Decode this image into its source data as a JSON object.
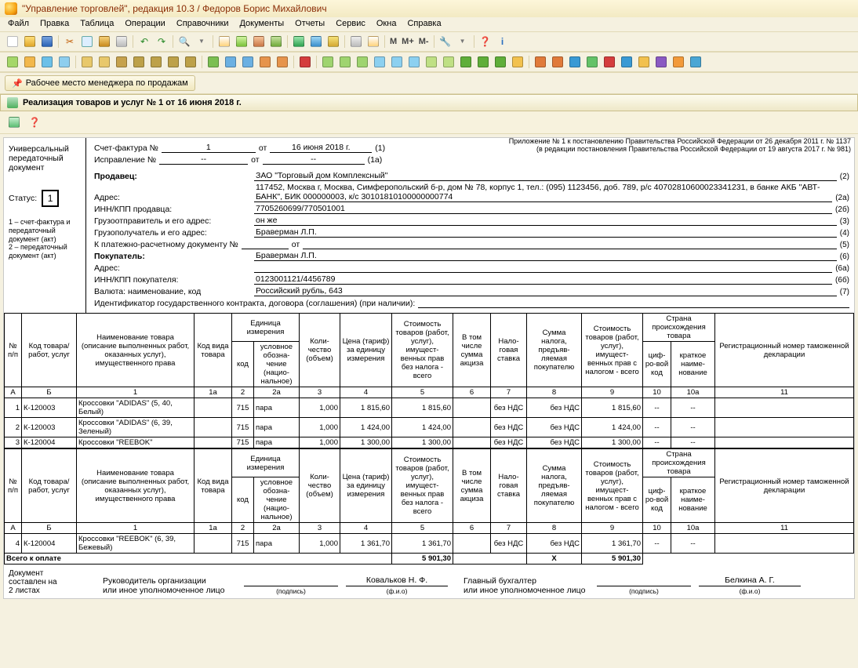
{
  "win": {
    "title": "\"Управление торговлей\", редакция 10.3 / Федоров Борис Михайлович"
  },
  "menu": [
    "Файл",
    "Правка",
    "Таблица",
    "Операции",
    "Справочники",
    "Документы",
    "Отчеты",
    "Сервис",
    "Окна",
    "Справка"
  ],
  "tb_text": {
    "m": "M",
    "mp": "M+",
    "mm": "M-"
  },
  "workspace_tab": "Рабочее место менеджера по продажам",
  "doc_tab": "Реализация товаров и услуг № 1 от 16 июня 2018 г.",
  "left": {
    "upd1": "Универсальный",
    "upd2": "передаточный",
    "upd3": "документ",
    "status_lbl": "Статус:",
    "status_val": "1",
    "note": "1 – счет-фактура и передаточный документ (акт)\n2 – передаточный документ (акт)"
  },
  "hdr_right": {
    "l1": "Приложение № 1 к постановлению Правительства Российской Федерации от 26 декабря 2011 г. № 1137",
    "l2": "(в редакции постановления Правительства Российской Федерации от 19 августа 2017 г. № 981)"
  },
  "hdr": {
    "sf_lbl": "Счет-фактура №",
    "sf_no": "1",
    "sf_ot": "от",
    "sf_date": "16 июня 2018 г.",
    "sf_tail": "(1)",
    "isp_lbl": "Исправление №",
    "isp_no": "--",
    "isp_ot": "от",
    "isp_date": "--",
    "isp_tail": "(1а)",
    "seller_lbl": "Продавец:",
    "seller": "ЗАО \"Торговый дом Комплексный\"",
    "seller_n": "(2)",
    "addr_lbl": "Адрес:",
    "addr": "117452, Москва г, Москва, Симферопольский б-р, дом № 78, корпус 1, тел.: (095) 1123456, доб. 789, р/с 40702810600023341231, в банке АКБ \"АВТ-БАНК\", БИК 000000003, к/с 30101810100000000774",
    "addr_n": "(2а)",
    "inn_s_lbl": "ИНН/КПП продавца:",
    "inn_s": "7705260699/770501001",
    "inn_s_n": "(2б)",
    "go_lbl": "Грузоотправитель и его адрес:",
    "go": "он же",
    "go_n": "(3)",
    "gp_lbl": "Грузополучатель и его адрес:",
    "gp": "Браверман Л.П.",
    "gp_n": "(4)",
    "prd_lbl": "К платежно-расчетному документу №",
    "prd_no": "",
    "prd_ot": "от",
    "prd_date": "",
    "prd_n": "(5)",
    "buyer_lbl": "Покупатель:",
    "buyer": "Браверман Л.П.",
    "buyer_n": "(6)",
    "baddr_lbl": "Адрес:",
    "baddr": "",
    "baddr_n": "(6а)",
    "inn_b_lbl": "ИНН/КПП покупателя:",
    "inn_b": "0123001121/4456789",
    "inn_b_n": "(6б)",
    "cur_lbl": "Валюта: наименование, код",
    "cur": "Российский рубль, 643",
    "cur_n": "(7)",
    "gov_lbl": "Идентификатор государственного контракта, договора (соглашения) (при наличии):"
  },
  "th": {
    "c1": "№ п/п",
    "c2": "Код товара/ работ, услуг",
    "c3": "Наименование товара (описание выполненных работ, оказанных услуг), имущественного права",
    "c4": "Код вида товара",
    "c5": "Единица измерения",
    "c5a": "код",
    "c5b": "условное обозна-чение (нацио-нальное)",
    "c6": "Коли-чество (объем)",
    "c7": "Цена (тариф) за единицу измерения",
    "c8": "Стоимость товаров (работ, услуг), имущест-венных прав без налога - всего",
    "c9": "В том числе сумма акциза",
    "c10": "Нало-говая ставка",
    "c11": "Сумма налога, предъяв-ляемая покупателю",
    "c12": "Стоимость товаров (работ, услуг), имущест-венных прав с налогом - всего",
    "c13": "Страна происхождения товара",
    "c13a": "циф-ро-вой код",
    "c13b": "краткое наиме-нование",
    "c14": "Регистрационный номер таможенной декларации"
  },
  "codes": [
    "А",
    "Б",
    "1",
    "1а",
    "2",
    "2а",
    "3",
    "4",
    "5",
    "6",
    "7",
    "8",
    "9",
    "10",
    "10а",
    "11"
  ],
  "rows1": [
    {
      "n": "1",
      "code": "К-120003",
      "name": "Кроссовки \"ADIDAS\" (5, 40, Белый)",
      "kind": "",
      "ucode": "715",
      "uname": "пара",
      "qty": "1,000",
      "price": "1 815,60",
      "sum": "1 815,60",
      "akc": "",
      "rate": "без НДС",
      "tax": "без НДС",
      "tot": "1 815,60",
      "cc": "--",
      "cn": "--",
      "dec": ""
    },
    {
      "n": "2",
      "code": "К-120003",
      "name": "Кроссовки \"ADIDAS\" (6, 39, Зеленый)",
      "kind": "",
      "ucode": "715",
      "uname": "пара",
      "qty": "1,000",
      "price": "1 424,00",
      "sum": "1 424,00",
      "akc": "",
      "rate": "без НДС",
      "tax": "без НДС",
      "tot": "1 424,00",
      "cc": "--",
      "cn": "--",
      "dec": ""
    },
    {
      "n": "3",
      "code": "К-120004",
      "name": "Кроссовки \"REEBOK\"",
      "kind": "",
      "ucode": "715",
      "uname": "пара",
      "qty": "1,000",
      "price": "1 300,00",
      "sum": "1 300,00",
      "akc": "",
      "rate": "без НДС",
      "tax": "без НДС",
      "tot": "1 300,00",
      "cc": "--",
      "cn": "--",
      "dec": ""
    }
  ],
  "rows2": [
    {
      "n": "4",
      "code": "К-120004",
      "name": "Кроссовки \"REEBOK\" (6, 39, Бежевый)",
      "kind": "",
      "ucode": "715",
      "uname": "пара",
      "qty": "1,000",
      "price": "1 361,70",
      "sum": "1 361,70",
      "akc": "",
      "rate": "без НДС",
      "tax": "без НДС",
      "tot": "1 361,70",
      "cc": "--",
      "cn": "--",
      "dec": ""
    }
  ],
  "total": {
    "lbl": "Всего к оплате",
    "sum": "5 901,30",
    "tax": "Х",
    "tot": "5 901,30"
  },
  "sign": {
    "left1": "Документ",
    "left2": "составлен на",
    "left3": "2 листах",
    "r1": "Руководитель организации",
    "r1b": "или иное уполномоченное лицо",
    "r2": "Главный бухгалтер",
    "r2b": "или иное уполномоченное лицо",
    "name1": "Ковальков  Н. Ф.",
    "name2": "Белкина А. Г.",
    "cap_sign": "(подпись)",
    "cap_fio": "(ф.и.о)"
  }
}
